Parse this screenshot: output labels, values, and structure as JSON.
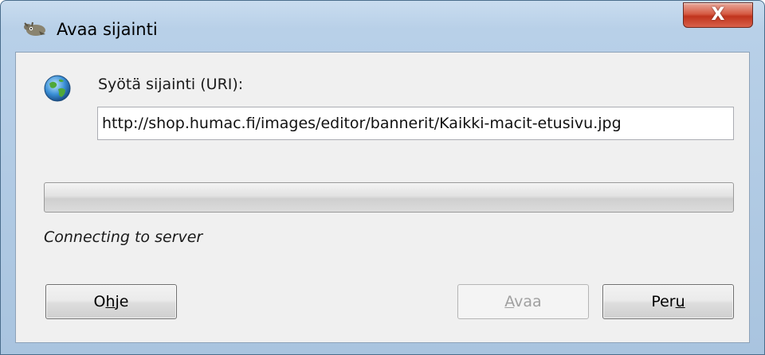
{
  "window": {
    "title": "Avaa sijainti",
    "close_label": "X"
  },
  "dialog": {
    "uri_label": "Syötä sijainti (URI):",
    "uri_value": "http://shop.humac.fi/images/editor/bannerit/Kaikki-macit-etusivu.jpg",
    "progress_fraction": 0,
    "status_text": "Connecting to server"
  },
  "buttons": {
    "help": {
      "pre": "O",
      "mnemonic": "h",
      "post": "je"
    },
    "open": {
      "pre": "",
      "mnemonic": "A",
      "post": "vaa",
      "disabled": true
    },
    "cancel": {
      "pre": "Per",
      "mnemonic": "u",
      "post": ""
    }
  },
  "icons": {
    "title": "gimp-wilber-icon",
    "globe": "globe-icon",
    "close": "close-icon"
  }
}
